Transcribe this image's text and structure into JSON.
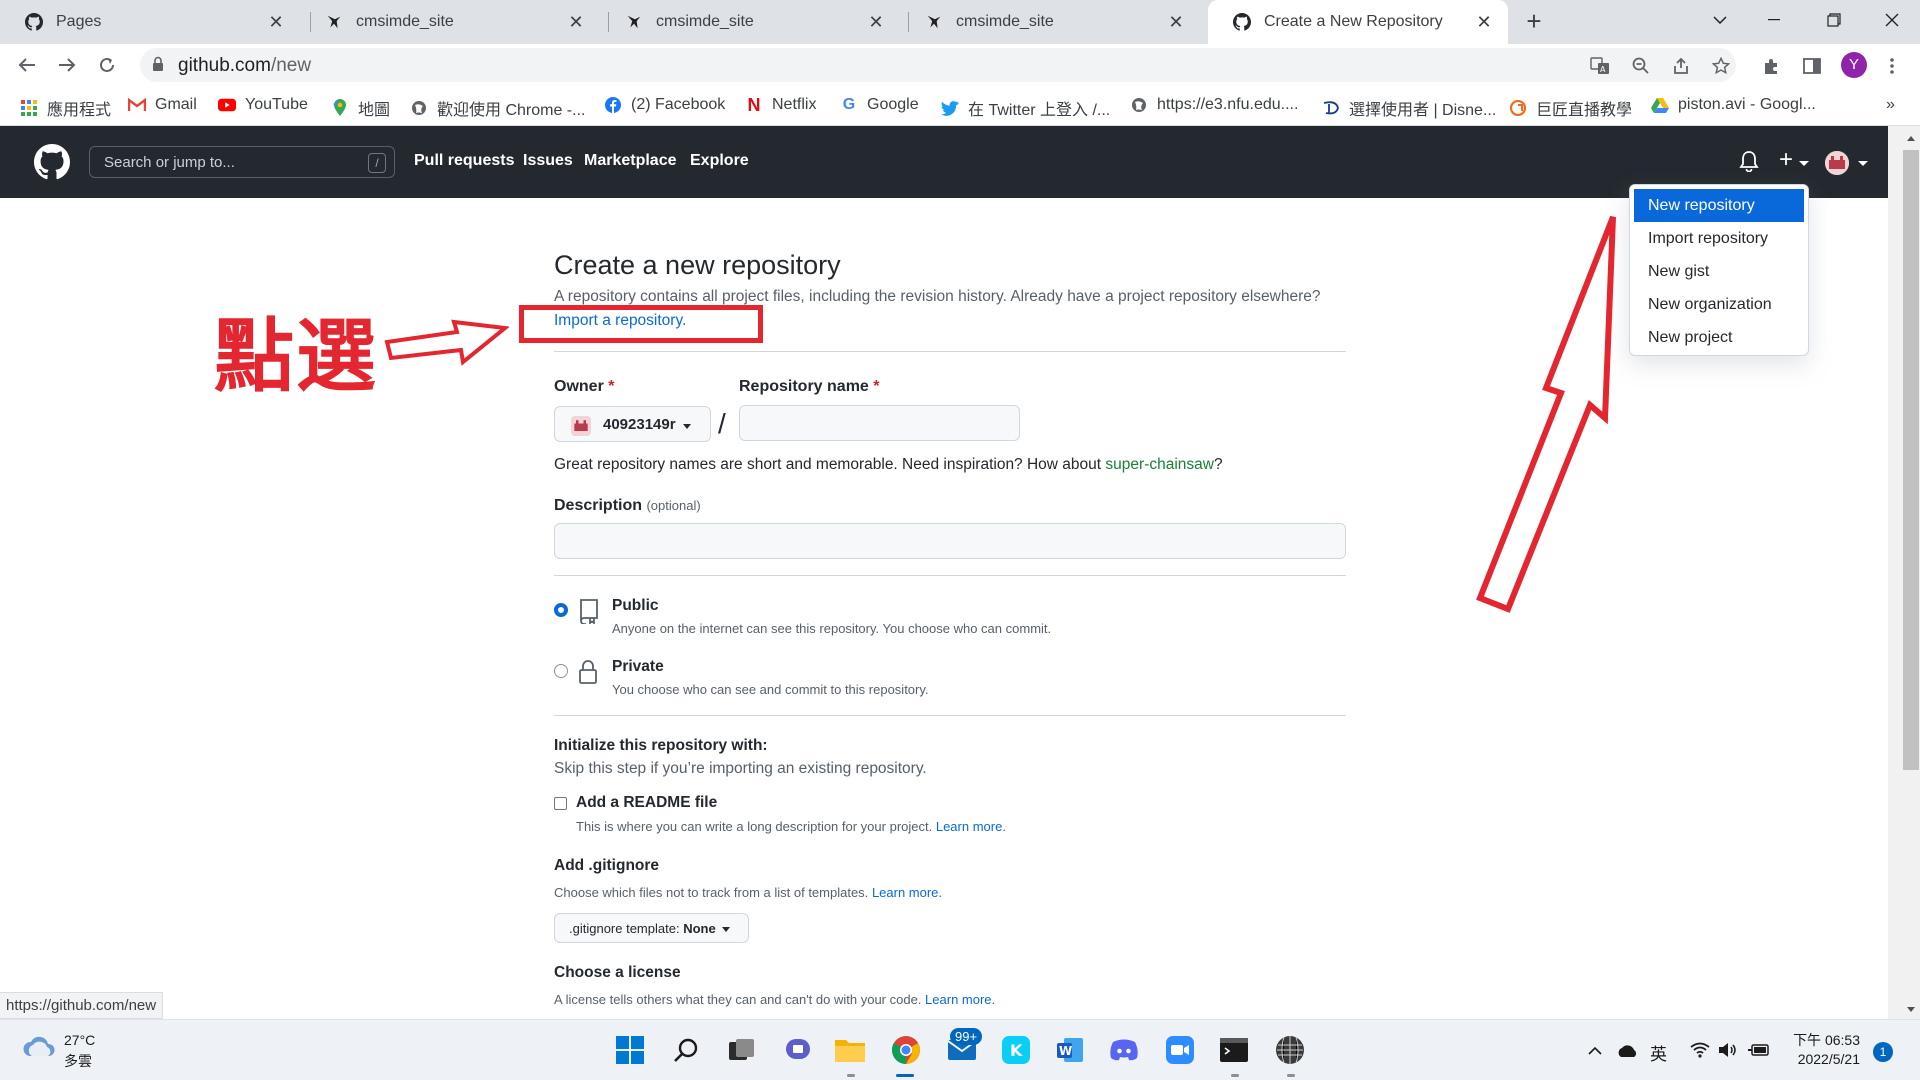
{
  "browser": {
    "tabs": [
      {
        "title": "Pages",
        "close": "✕"
      },
      {
        "title": "cmsimde_site",
        "close": "✕"
      },
      {
        "title": "cmsimde_site",
        "close": "✕"
      },
      {
        "title": "cmsimde_site",
        "close": "✕"
      },
      {
        "title": "Create a New Repository",
        "close": "✕"
      }
    ],
    "new_tab": "+",
    "url_domain": "github.com",
    "url_path": "/new",
    "profile_initial": "Y",
    "status_url": "https://github.com/new"
  },
  "bookmarks": [
    {
      "label": "應用程式",
      "icon": "apps-grid-icon"
    },
    {
      "label": "Gmail",
      "icon": "gmail-icon"
    },
    {
      "label": "YouTube",
      "icon": "youtube-icon"
    },
    {
      "label": "地圖",
      "icon": "maps-icon"
    },
    {
      "label": "歡迎使用 Chrome -...",
      "icon": "globe-icon"
    },
    {
      "label": "(2) Facebook",
      "icon": "facebook-icon"
    },
    {
      "label": "Netflix",
      "icon": "netflix-icon"
    },
    {
      "label": "Google",
      "icon": "google-icon"
    },
    {
      "label": "在 Twitter 上登入 /...",
      "icon": "twitter-icon"
    },
    {
      "label": "https://e3.nfu.edu....",
      "icon": "globe-icon"
    },
    {
      "label": "選擇使用者 | Disne...",
      "icon": "disney-icon"
    },
    {
      "label": "巨匠直播教學",
      "icon": "gjun-icon"
    },
    {
      "label": "piston.avi - Googl...",
      "icon": "drive-icon"
    }
  ],
  "bookmarks_more": "»",
  "github": {
    "search_placeholder": "Search or jump to...",
    "search_key": "/",
    "nav": [
      "Pull requests",
      "Issues",
      "Marketplace",
      "Explore"
    ],
    "plus": "+",
    "dropdown": [
      "New repository",
      "Import repository",
      "New gist",
      "New organization",
      "New project"
    ]
  },
  "page": {
    "title": "Create a new repository",
    "intro": "A repository contains all project files, including the revision history. Already have a project repository elsewhere?",
    "import_link": "Import a repository.",
    "owner_label": "Owner",
    "repo_label": "Repository name",
    "required_mark": "*",
    "owner_value": "40923149r",
    "path_separator": "/",
    "hint_prefix": "Great repository names are short and memorable. Need inspiration? How about ",
    "hint_suggestion": "super-chainsaw",
    "hint_suffix": "?",
    "description_label": "Description",
    "description_optional": "(optional)",
    "public_title": "Public",
    "public_desc": "Anyone on the internet can see this repository. You choose who can commit.",
    "private_title": "Private",
    "private_desc": "You choose who can see and commit to this repository.",
    "init_title": "Initialize this repository with:",
    "init_sub": "Skip this step if you’re importing an existing repository.",
    "readme_label": "Add a README file",
    "readme_desc": "This is where you can write a long description for your project.",
    "learn_more": "Learn more.",
    "gitignore_title": "Add .gitignore",
    "gitignore_desc": "Choose which files not to track from a list of templates.",
    "gitignore_select_prefix": ".gitignore template:",
    "gitignore_select_value": "None",
    "license_title": "Choose a license",
    "license_desc": "A license tells others what they can and can't do with your code."
  },
  "annotation": {
    "text": "點選"
  },
  "taskbar": {
    "temperature": "27°C",
    "condition": "多雲",
    "mail_badge": "99+",
    "ime": "英",
    "time": "下午 06:53",
    "date": "2022/5/21",
    "notifications": "1"
  },
  "colors": {
    "gh_header": "#24292f",
    "link": "#0969da",
    "annotation_red": "#e3262f",
    "dropdown_active": "#0969da"
  }
}
